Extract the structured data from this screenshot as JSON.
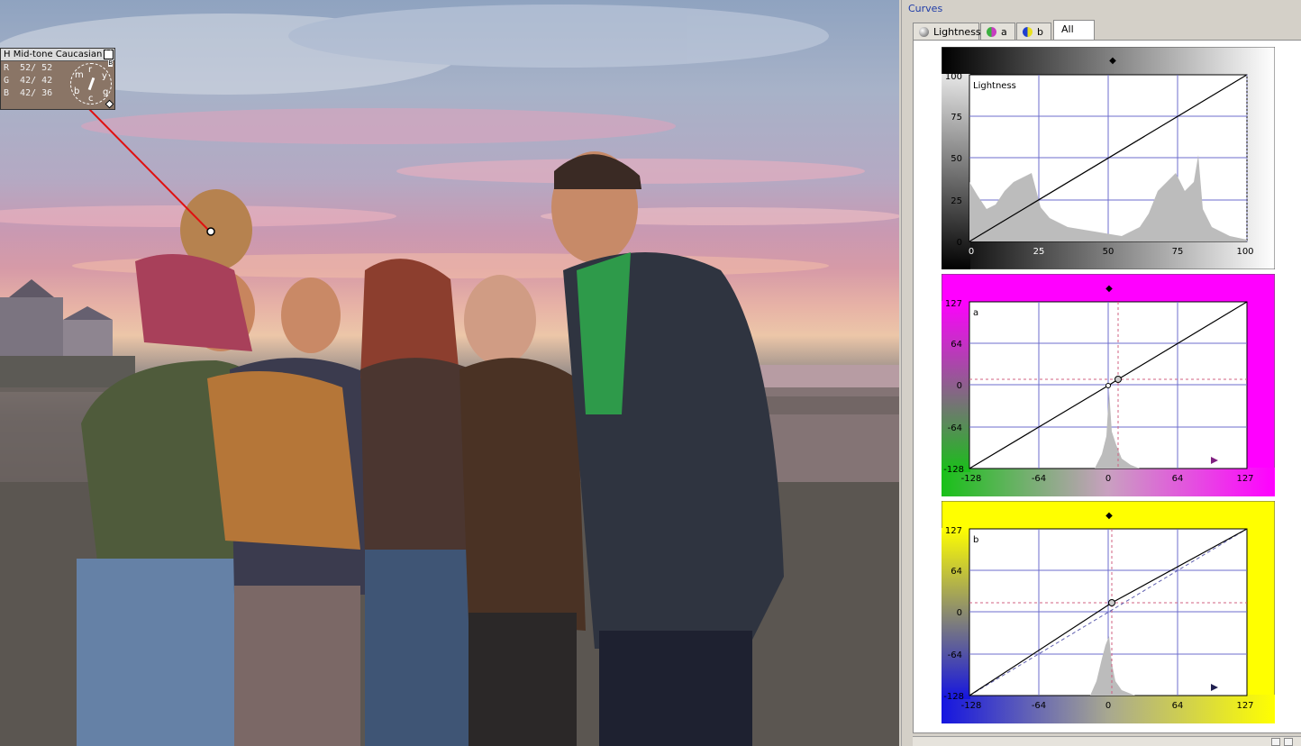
{
  "picker": {
    "title": "H Mid-tone Caucasian",
    "close": "✕",
    "rows": [
      "R  52/ 52",
      "G  42/ 42",
      "B  42/ 36"
    ],
    "wheel_labels": {
      "m": "m",
      "r": "r",
      "y": "y",
      "b": "b",
      "c": "c",
      "g": "g"
    },
    "tiny_label": "B"
  },
  "panel": {
    "title": "Curves",
    "tabs": [
      {
        "label": "Lightness",
        "icon": "lightness-icon",
        "color": "#808080"
      },
      {
        "label": "a",
        "icon": "a-channel-icon",
        "color": "#b03aa8"
      },
      {
        "label": "b",
        "icon": "b-channel-icon",
        "color": "#5aa83a"
      },
      {
        "label": "All",
        "active": true
      }
    ]
  },
  "curves": [
    {
      "name": "lightness",
      "channel_label": "Lightness",
      "y_ticks": [
        "100",
        "75",
        "50",
        "25",
        "0"
      ],
      "x_ticks": [
        "0",
        "25",
        "50",
        "75",
        "100"
      ],
      "colors": {
        "left": "#000000",
        "right": "#ffffff",
        "frame": "#7a7a7a"
      },
      "marker": "◆"
    },
    {
      "name": "a",
      "channel_label": "a",
      "y_ticks": [
        "127",
        "64",
        "0",
        "-64",
        "-128"
      ],
      "x_ticks": [
        "-128",
        "-64",
        "0",
        "64",
        "127"
      ],
      "colors": {
        "low": "#19c019",
        "high": "#ff00ff"
      },
      "marker": "◆"
    },
    {
      "name": "b",
      "channel_label": "b",
      "y_ticks": [
        "127",
        "64",
        "0",
        "-64",
        "-128"
      ],
      "x_ticks": [
        "-128",
        "-64",
        "0",
        "64",
        "127"
      ],
      "colors": {
        "low": "#1515e0",
        "high": "#ffff00"
      },
      "marker": "◆"
    }
  ]
}
